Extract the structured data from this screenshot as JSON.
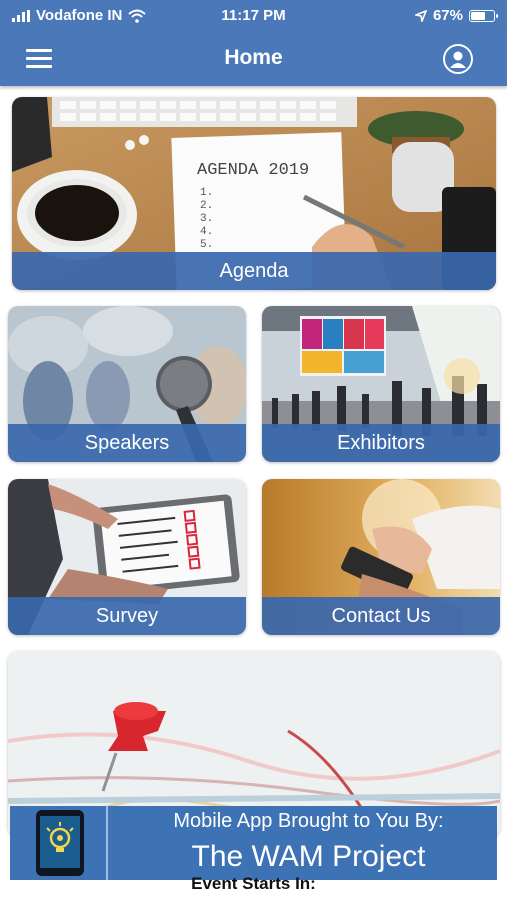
{
  "status_bar": {
    "carrier": "Vodafone IN",
    "time": "11:17 PM",
    "battery": "67%",
    "battery_level": 0.67
  },
  "header": {
    "title": "Home",
    "menu_icon": "hamburger-menu-icon",
    "profile_icon": "user-profile-icon"
  },
  "tiles": {
    "agenda": {
      "label": "Agenda",
      "image_text": "AGENDA 2019",
      "list_numbers": [
        "1.",
        "2.",
        "3.",
        "4.",
        "5."
      ]
    },
    "speakers": {
      "label": "Speakers"
    },
    "exhibitors": {
      "label": "Exhibitors"
    },
    "survey": {
      "label": "Survey"
    },
    "contact": {
      "label": "Contact Us"
    }
  },
  "banner": {
    "line1": "Mobile App Brought to You By:",
    "line2": "The WAM Project"
  },
  "footer": {
    "event_text": "Event Starts In:"
  },
  "colors": {
    "brand_blue": "#4a78b8",
    "tile_label_bar": "#3a68ac",
    "pin_red": "#d8262e"
  }
}
